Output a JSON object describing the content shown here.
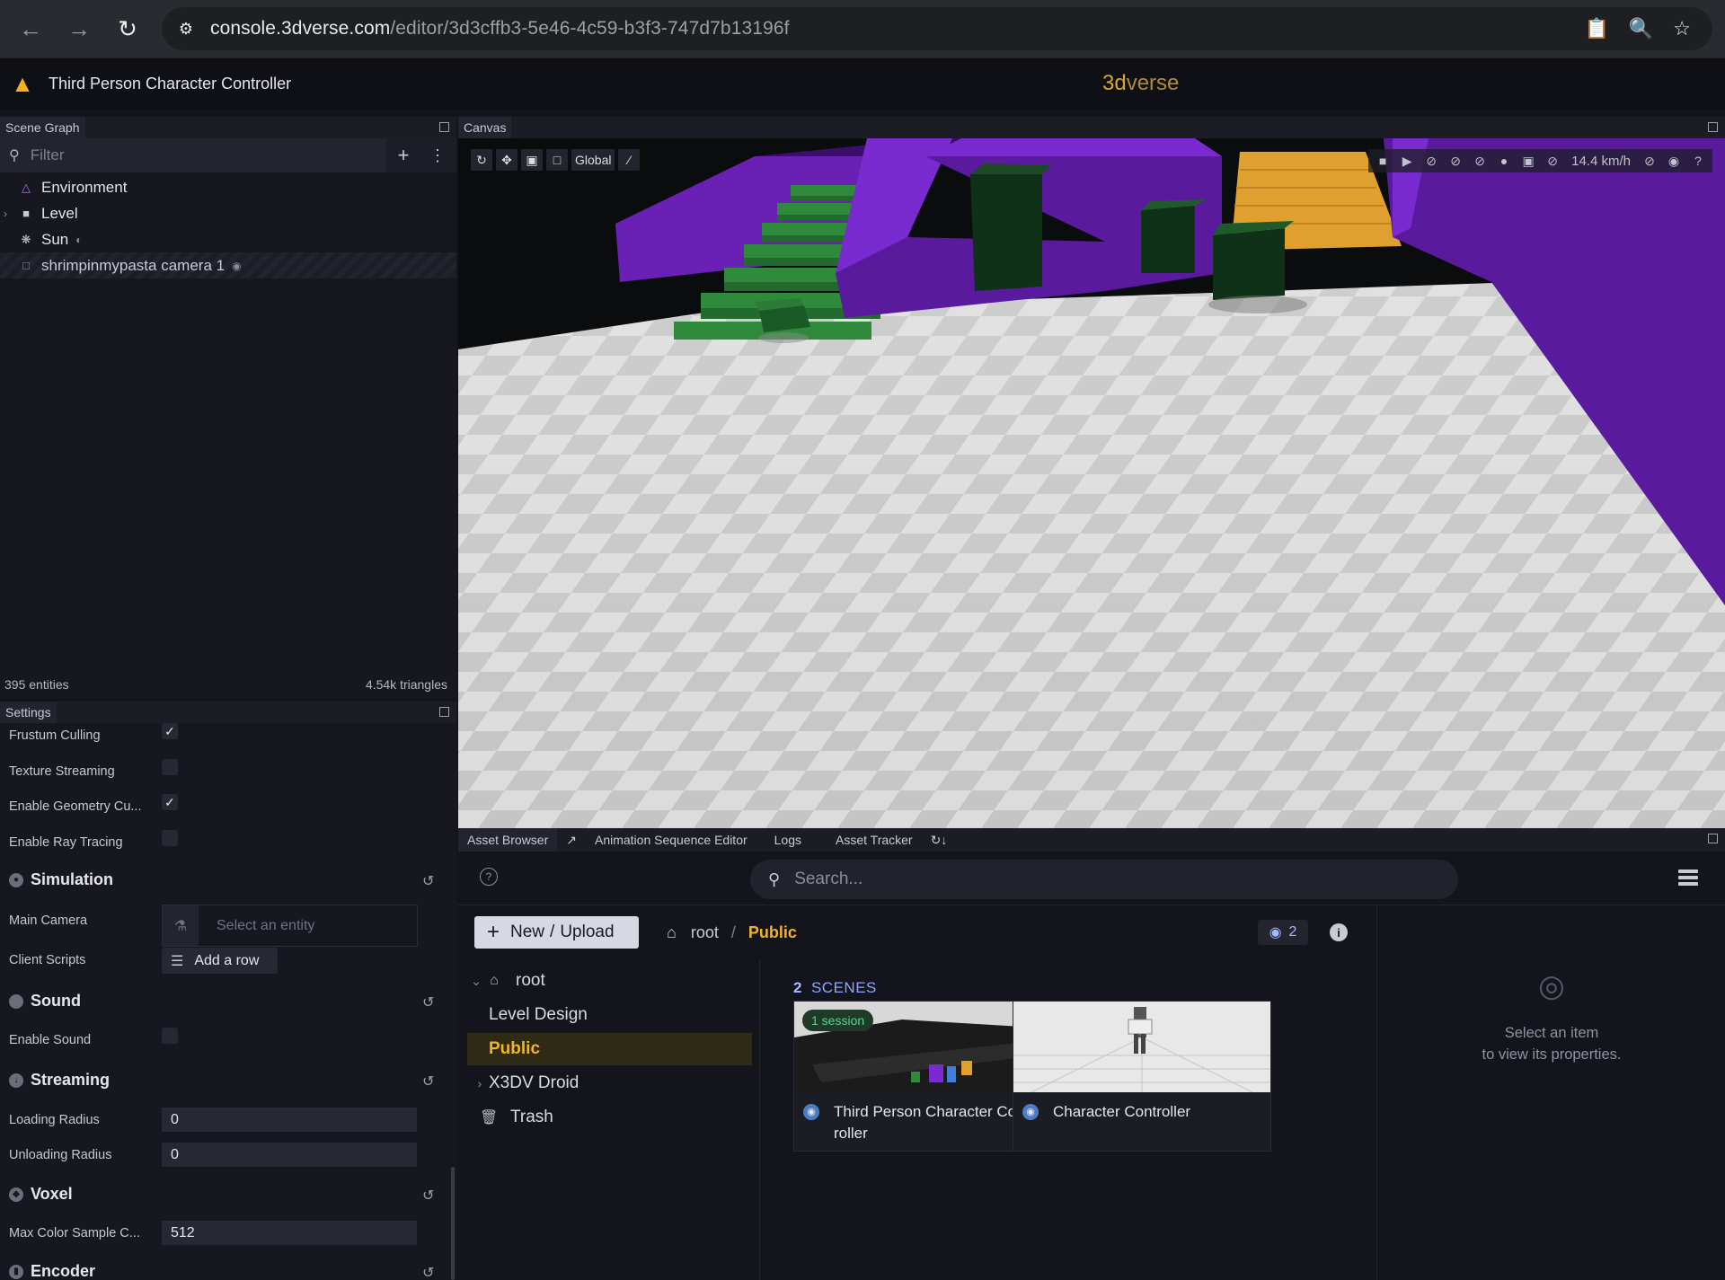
{
  "browser": {
    "url_host": "console.3dverse.com",
    "url_path": "/editor/3d3cffb3-5e46-4c59-b3f3-747d7b13196f"
  },
  "app": {
    "title": "Third Person Character Controller",
    "brand_prefix": "3d",
    "brand_suffix": "verse",
    "accent_color": "#f0b429"
  },
  "scene_graph": {
    "panel_title": "Scene Graph",
    "filter_placeholder": "Filter",
    "items": [
      {
        "label": "Environment",
        "icon": "environment-icon"
      },
      {
        "label": "Level",
        "icon": "cube-icon"
      },
      {
        "label": "Sun",
        "icon": "sun-icon"
      },
      {
        "label": "shrimpinmypasta camera 1",
        "icon": "camera-icon"
      }
    ],
    "entities": "395 entities",
    "triangles": "4.54k triangles"
  },
  "settings": {
    "panel_title": "Settings",
    "frustum_culling": "Frustum Culling",
    "texture_streaming": "Texture Streaming",
    "geometry_culling": "Enable Geometry Cu...",
    "ray_tracing": "Enable Ray Tracing",
    "simulation": "Simulation",
    "main_camera": "Main Camera",
    "main_camera_placeholder": "Select an entity",
    "client_scripts": "Client Scripts",
    "add_row": "Add a row",
    "sound": "Sound",
    "enable_sound": "Enable Sound",
    "streaming": "Streaming",
    "loading_radius": "Loading Radius",
    "loading_radius_value": "0",
    "unloading_radius": "Unloading Radius",
    "unloading_radius_value": "0",
    "voxel": "Voxel",
    "max_color": "Max Color Sample C...",
    "max_color_value": "512",
    "encoder": "Encoder"
  },
  "canvas": {
    "panel_title": "Canvas",
    "space_mode": "Global",
    "speed": "14.4 km/h"
  },
  "asset_browser": {
    "tabs": [
      "Asset Browser",
      "Animation Sequence Editor",
      "Logs",
      "Asset Tracker"
    ],
    "search_placeholder": "Search...",
    "new_label": "New",
    "upload_label": "Upload",
    "crumb_root": "root",
    "crumb_current": "Public",
    "scene_count": "2",
    "folders": [
      {
        "label": "root",
        "icon": "home-icon"
      },
      {
        "label": "Level Design"
      },
      {
        "label": "Public"
      },
      {
        "label": "X3DV Droid"
      },
      {
        "label": "Trash",
        "icon": "trash-icon"
      }
    ],
    "scenes_count": "2",
    "scenes_label": "SCENES",
    "scenes": [
      {
        "title": "Third Person Character Cont roller",
        "badge": "1 session"
      },
      {
        "title": "Character Controller"
      }
    ],
    "props_line1": "Select an item",
    "props_line2": "to view its properties."
  }
}
